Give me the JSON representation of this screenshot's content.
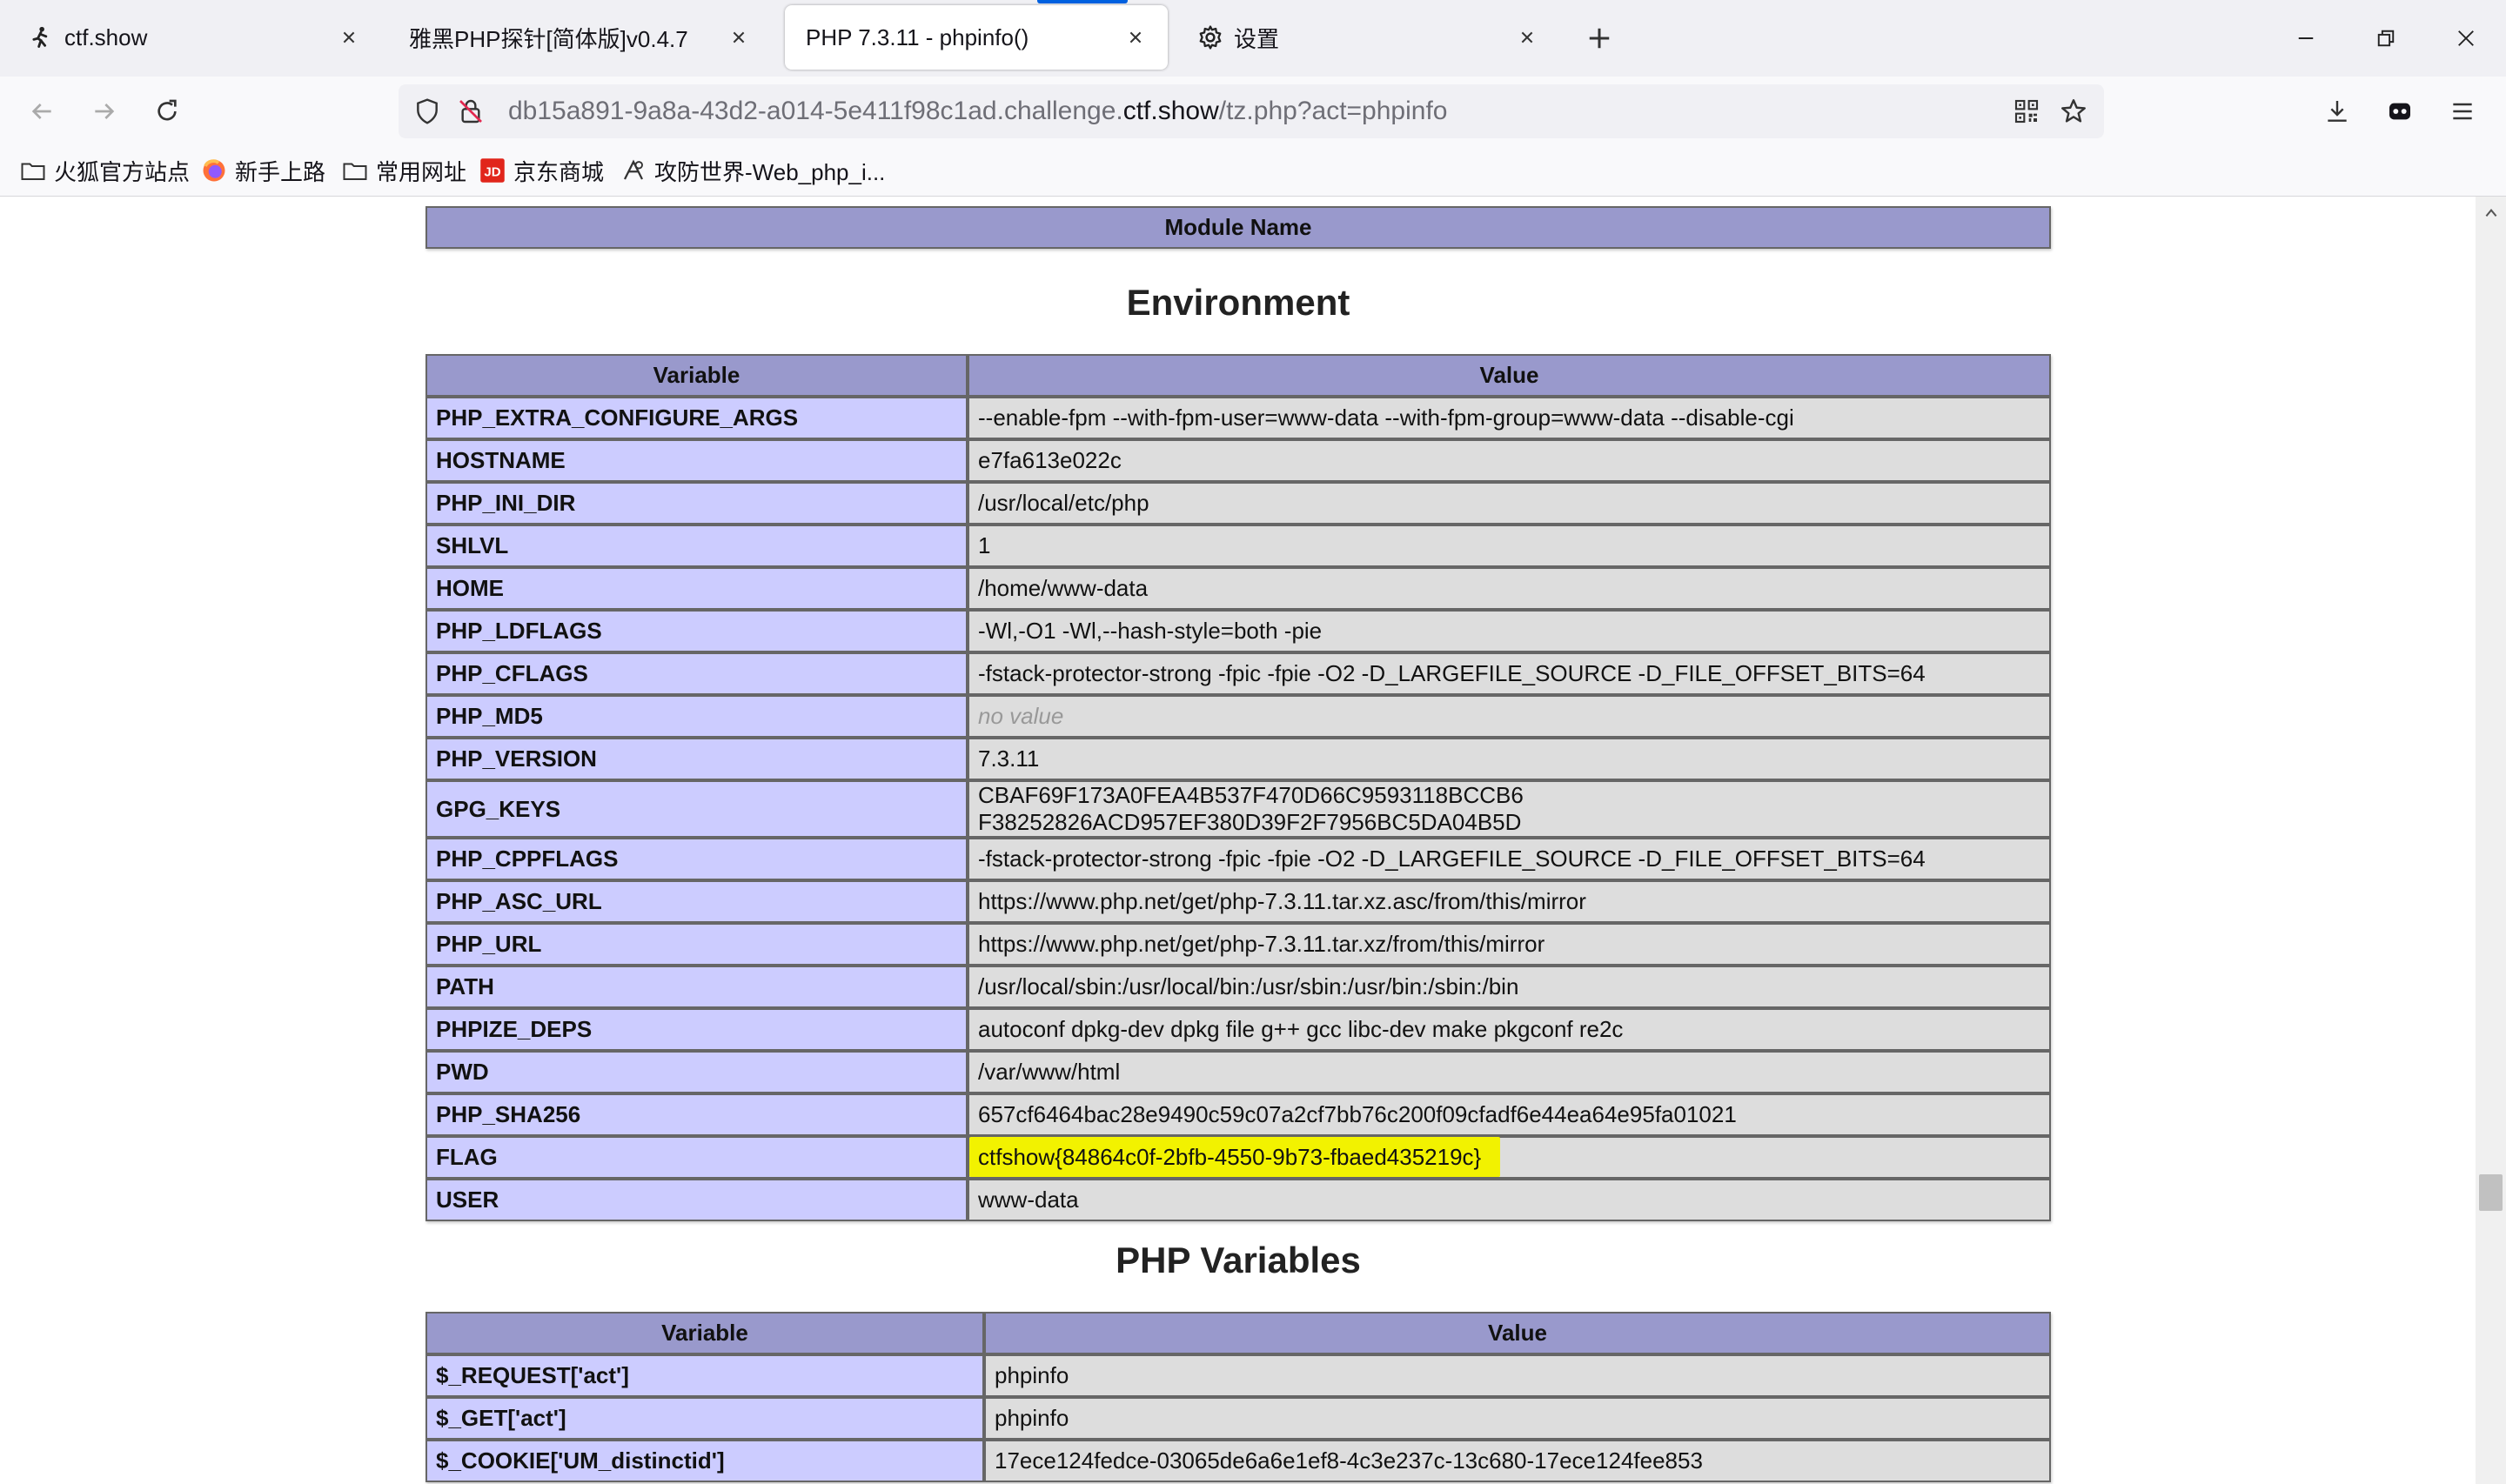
{
  "browser": {
    "tabs": [
      {
        "title": "ctf.show",
        "active": false,
        "icon": "ctfshow-runner-icon"
      },
      {
        "title": "雅黑PHP探针[简体版]v0.4.7",
        "active": false,
        "icon": "none"
      },
      {
        "title": "PHP 7.3.11 - phpinfo()",
        "active": true,
        "icon": "none"
      },
      {
        "title": "设置",
        "active": false,
        "icon": "gear-icon"
      }
    ],
    "url": {
      "prefix": "db15a891-9a8a-43d2-a014-5e411f98c1ad.challenge.",
      "domain": "ctf.show",
      "suffix": "/tz.php?act=phpinfo"
    },
    "bookmarks": [
      {
        "label": "火狐官方站点",
        "icon": "folder-icon"
      },
      {
        "label": "新手上路",
        "icon": "firefox-icon"
      },
      {
        "label": "常用网址",
        "icon": "folder-icon"
      },
      {
        "label": "京东商城",
        "icon": "jd-icon"
      },
      {
        "label": "攻防世界-Web_php_i...",
        "icon": "adworld-icon"
      }
    ],
    "accent_color": "#0061e0"
  },
  "page": {
    "module_header": "Module Name",
    "environment_title": "Environment",
    "environment_headers": {
      "variable": "Variable",
      "value": "Value"
    },
    "environment_rows": [
      {
        "name": "PHP_EXTRA_CONFIGURE_ARGS",
        "value": "--enable-fpm --with-fpm-user=www-data --with-fpm-group=www-data --disable-cgi"
      },
      {
        "name": "HOSTNAME",
        "value": "e7fa613e022c"
      },
      {
        "name": "PHP_INI_DIR",
        "value": "/usr/local/etc/php"
      },
      {
        "name": "SHLVL",
        "value": "1"
      },
      {
        "name": "HOME",
        "value": "/home/www-data"
      },
      {
        "name": "PHP_LDFLAGS",
        "value": "-Wl,-O1 -Wl,--hash-style=both -pie"
      },
      {
        "name": "PHP_CFLAGS",
        "value": "-fstack-protector-strong -fpic -fpie -O2 -D_LARGEFILE_SOURCE -D_FILE_OFFSET_BITS=64"
      },
      {
        "name": "PHP_MD5",
        "value": "no value",
        "no_value": true
      },
      {
        "name": "PHP_VERSION",
        "value": "7.3.11"
      },
      {
        "name": "GPG_KEYS",
        "value": "CBAF69F173A0FEA4B537F470D66C9593118BCCB6 F38252826ACD957EF380D39F2F7956BC5DA04B5D"
      },
      {
        "name": "PHP_CPPFLAGS",
        "value": "-fstack-protector-strong -fpic -fpie -O2 -D_LARGEFILE_SOURCE -D_FILE_OFFSET_BITS=64"
      },
      {
        "name": "PHP_ASC_URL",
        "value": "https://www.php.net/get/php-7.3.11.tar.xz.asc/from/this/mirror"
      },
      {
        "name": "PHP_URL",
        "value": "https://www.php.net/get/php-7.3.11.tar.xz/from/this/mirror"
      },
      {
        "name": "PATH",
        "value": "/usr/local/sbin:/usr/local/bin:/usr/sbin:/usr/bin:/sbin:/bin"
      },
      {
        "name": "PHPIZE_DEPS",
        "value": "autoconf dpkg-dev dpkg file g++ gcc libc-dev make pkgconf re2c"
      },
      {
        "name": "PWD",
        "value": "/var/www/html"
      },
      {
        "name": "PHP_SHA256",
        "value": "657cf6464bac28e9490c59c07a2cf7bb76c200f09cfadf6e44ea64e95fa01021"
      },
      {
        "name": "FLAG",
        "value": "ctfshow{84864c0f-2bfb-4550-9b73-fbaed435219c}",
        "highlight": true
      },
      {
        "name": "USER",
        "value": "www-data"
      }
    ],
    "php_variables_title": "PHP Variables",
    "php_variables_headers": {
      "variable": "Variable",
      "value": "Value"
    },
    "php_variables_rows": [
      {
        "name": "$_REQUEST['act']",
        "value": "phpinfo"
      },
      {
        "name": "$_GET['act']",
        "value": "phpinfo"
      },
      {
        "name": "$_COOKIE['UM_distinctid']",
        "value": "17ece124fedce-03065de6a6e1ef8-4c3e237c-13c680-17ece124fee853"
      }
    ],
    "colors": {
      "header_bg": "#9999cc",
      "key_bg": "#ccccff",
      "value_bg": "#dddddd",
      "highlight": "#f2f200"
    }
  }
}
